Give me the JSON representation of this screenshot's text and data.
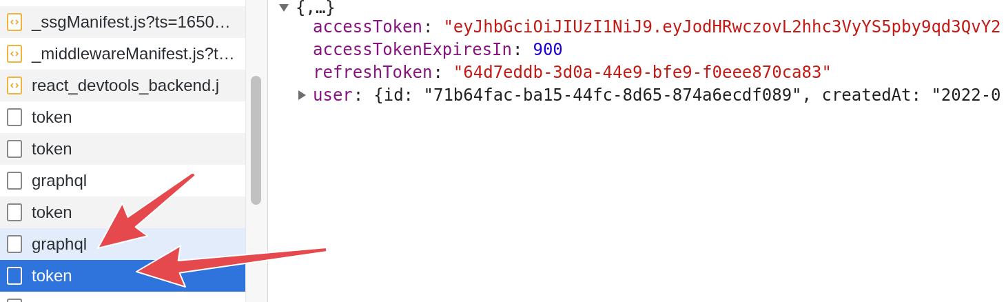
{
  "requests": [
    {
      "name": "_ssgManifest.js?ts=1650…",
      "kind": "script",
      "selected": false,
      "hovered": false
    },
    {
      "name": "_middlewareManifest.js?t…",
      "kind": "script",
      "selected": false,
      "hovered": false
    },
    {
      "name": "react_devtools_backend.j",
      "kind": "script",
      "selected": false,
      "hovered": false
    },
    {
      "name": "token",
      "kind": "doc",
      "selected": false,
      "hovered": false
    },
    {
      "name": "token",
      "kind": "doc",
      "selected": false,
      "hovered": false
    },
    {
      "name": "graphql",
      "kind": "doc",
      "selected": false,
      "hovered": false
    },
    {
      "name": "token",
      "kind": "doc",
      "selected": false,
      "hovered": false
    },
    {
      "name": "graphql",
      "kind": "doc",
      "selected": false,
      "hovered": true
    },
    {
      "name": "token",
      "kind": "doc",
      "selected": true,
      "hovered": false
    },
    {
      "kind": "doc",
      "selected": false,
      "hovered": false
    }
  ],
  "preview": {
    "expanded": true,
    "summary": "{,…}",
    "properties": [
      {
        "key": "accessToken",
        "separator": ":",
        "value": "\"eyJhbGciOiJIUzI1NiJ9.eyJodHRwczovL2hhc3VyYS5pby9qd3QvY2",
        "kind": "string"
      },
      {
        "key": "accessTokenExpiresIn",
        "separator": ":",
        "value": "900",
        "kind": "number"
      },
      {
        "key": "refreshToken",
        "separator": ":",
        "value": "\"64d7eddb-3d0a-44e9-bfe9-f0eee870ca83\"",
        "kind": "string"
      },
      {
        "key": "user",
        "separator": ":",
        "value": "{id: \"71b64fac-ba15-44fc-8d65-874a6ecdf089\", createdAt: \"2022-0",
        "kind": "object",
        "expanded": false
      }
    ]
  },
  "annotations": [
    {
      "kind": "arrow"
    },
    {
      "kind": "arrow"
    }
  ]
}
